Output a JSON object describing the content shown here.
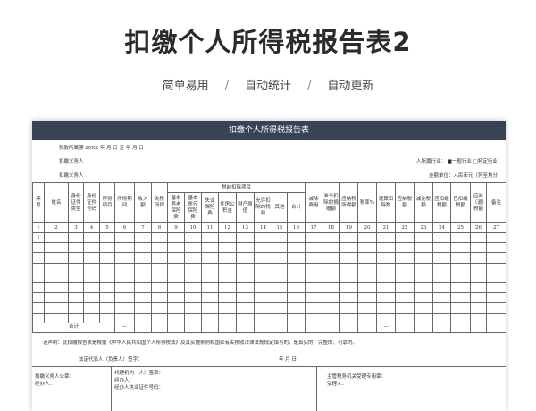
{
  "hero": {
    "title": "扣缴个人所得税报告表2",
    "features": [
      "简单易用",
      "自动统计",
      "自动更新"
    ],
    "separator": "/"
  },
  "sheet": {
    "title": "扣缴个人所得税报告表",
    "meta": {
      "period": "税款所属期   20XX 年  月  日 至     年    月    日",
      "withholder": "扣缴义务人",
      "industry": "人所属行业：  ■一般行业  □特定行业",
      "withholder2": "扣缴义务人",
      "unit": "金额单位：人民币元（列至角分"
    },
    "headers": {
      "group": "税前扣除项目",
      "cols": [
        "序号",
        "姓名",
        "身份证件类型",
        "身份证件号码",
        "所得项目",
        "所得期间",
        "收入额",
        "免税所得",
        "基本养老保险费",
        "基本医疗保险费",
        "失业保险费",
        "住房公积金",
        "财产原值",
        "允许扣除的税费",
        "其他",
        "合计",
        "减除费用",
        "准予扣除的捐赠额",
        "应纳税所得额",
        "税率%",
        "速算扣除数",
        "应纳税额",
        "减免税额",
        "应扣缴税额",
        "已扣缴税额",
        "应补（退）税额",
        "备注"
      ],
      "numbers": [
        "1",
        "2",
        "3",
        "4",
        "5",
        "6",
        "7",
        "8",
        "9",
        "10",
        "11",
        "12",
        "13",
        "14",
        "15",
        "16",
        "17",
        "18",
        "19",
        "20",
        "21",
        "22",
        "23",
        "24",
        "25",
        "26",
        "27"
      ]
    },
    "rows": [
      {
        "seq": "1"
      },
      {
        "seq": ""
      },
      {
        "seq": ""
      },
      {
        "seq": ""
      },
      {
        "seq": ""
      },
      {
        "seq": ""
      },
      {
        "seq": ""
      },
      {
        "seq": ""
      },
      {
        "seq": ""
      }
    ],
    "total": {
      "label": "合计",
      "dash": "—"
    },
    "declaration": "谨声明：此扣缴报告表是根据《中华人民共和国个人所得税法》及其实施条例和国家有关税收法律法规规定填写的，是真实的、完整的、可靠的。",
    "legal_rep": "法定代表人（负责人）签字：",
    "date": "年      月      日",
    "seal": "扣缴义务人公章：",
    "handler": "经办人：",
    "agency": "代理机构（人）签章：",
    "agency_handler": "经办人：",
    "agency_id": "经办人执业证件号码：",
    "tax_office": "主管税务机关受理专用章：",
    "receiver": "受理人："
  }
}
